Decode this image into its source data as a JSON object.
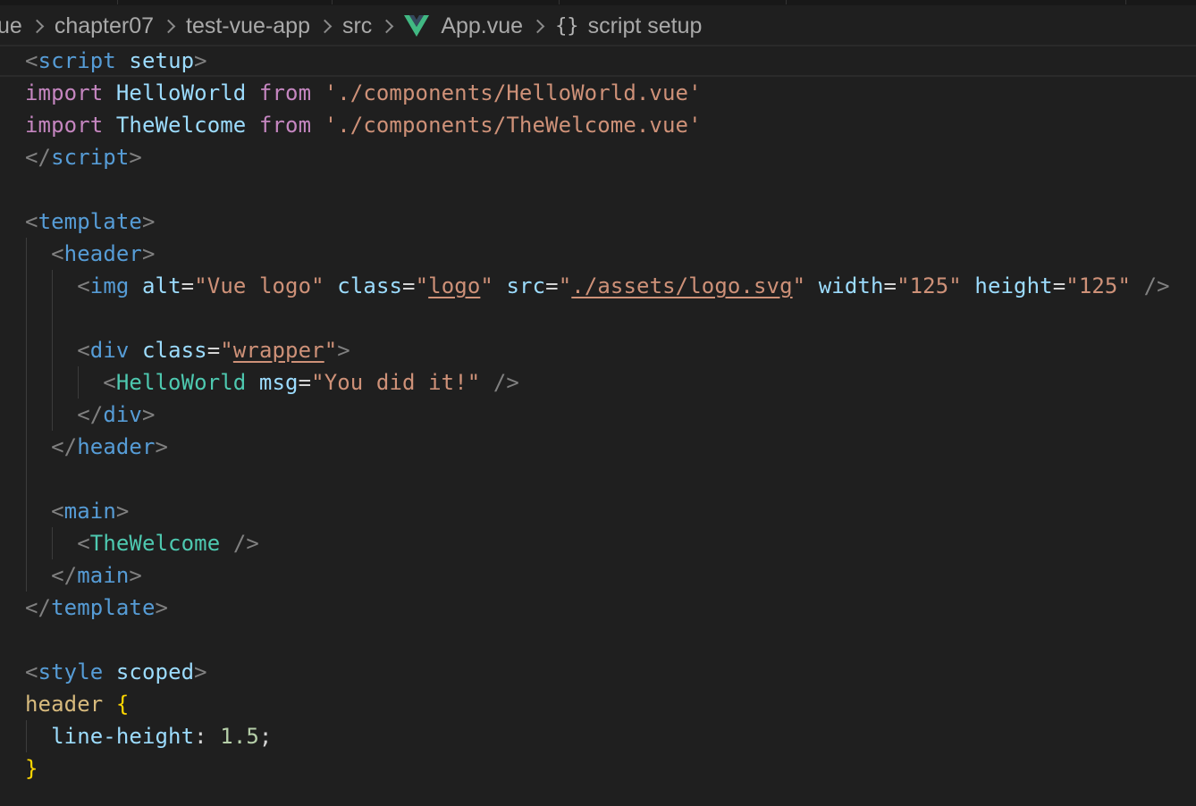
{
  "breadcrumb": {
    "items": [
      "ue",
      "chapter07",
      "test-vue-app",
      "src",
      "App.vue",
      "script setup"
    ],
    "vue_icon": "vue-logo-icon",
    "symbol_icon": "braces-icon"
  },
  "colors": {
    "background": "#1f1f1f",
    "tag": "#569cd6",
    "component": "#4ec9b0",
    "attribute": "#9cdcfe",
    "string": "#ce9178",
    "keyword": "#c586c0",
    "selector": "#d7ba7d",
    "bracket": "#ffd700",
    "number": "#b5cea8"
  },
  "code": {
    "l1": {
      "tag": "script",
      "attr": "setup"
    },
    "l2": {
      "kw1": "import",
      "name": "HelloWorld",
      "kw2": "from",
      "path": "'./components/HelloWorld.vue'"
    },
    "l3": {
      "kw1": "import",
      "name": "TheWelcome",
      "kw2": "from",
      "path": "'./components/TheWelcome.vue'"
    },
    "l4": {
      "tag": "script"
    },
    "l6": {
      "tag": "template"
    },
    "l7": {
      "tag": "header"
    },
    "l8": {
      "tag": "img",
      "a1": "alt",
      "v1": "Vue logo",
      "a2": "class",
      "v2": "logo",
      "a3": "src",
      "v3": "./assets/logo.svg",
      "a4": "width",
      "v4": "125",
      "a5": "height",
      "v5": "125"
    },
    "l10": {
      "tag": "div",
      "a1": "class",
      "v1": "wrapper"
    },
    "l11": {
      "tag": "HelloWorld",
      "a1": "msg",
      "v1": "You did it!"
    },
    "l12": {
      "tag": "div"
    },
    "l13": {
      "tag": "header"
    },
    "l15": {
      "tag": "main"
    },
    "l16": {
      "tag": "TheWelcome"
    },
    "l17": {
      "tag": "main"
    },
    "l18": {
      "tag": "template"
    },
    "l20": {
      "tag": "style",
      "attr": "scoped"
    },
    "l21": {
      "selector": "header",
      "open": "{"
    },
    "l22": {
      "prop": "line-height",
      "value": "1.5"
    },
    "l23": {
      "close": "}"
    }
  }
}
